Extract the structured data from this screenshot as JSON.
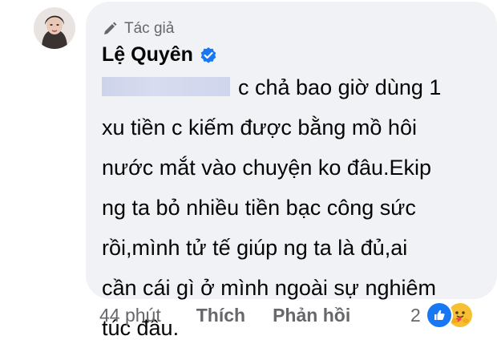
{
  "comment": {
    "author_badge": "Tác giả",
    "author_name": "Lệ Quyên",
    "text_lines": [
      "c chả bao giờ dùng 1",
      "xu tiền c kiếm được bằng mồ hôi",
      "nước mắt vào chuyện ko đâu.Ekip",
      "ng ta bỏ nhiều tiền bạc công sức",
      "rồi,mình tử tế giúp ng ta là đủ,ai",
      "cần cái gì ở mình ngoài sự nghiêm",
      "túc đâu."
    ]
  },
  "actions": {
    "time": "44 phút",
    "like_label": "Thích",
    "reply_label": "Phản hồi"
  },
  "reactions": {
    "count": "2",
    "types": [
      "like-icon",
      "care-icon"
    ]
  },
  "icons": {
    "badge": "pencil-icon",
    "verified": "verified-badge-icon"
  },
  "colors": {
    "bubble": "#f0f2f5",
    "secondary_text": "#65676b",
    "verified": "#1877f2"
  }
}
